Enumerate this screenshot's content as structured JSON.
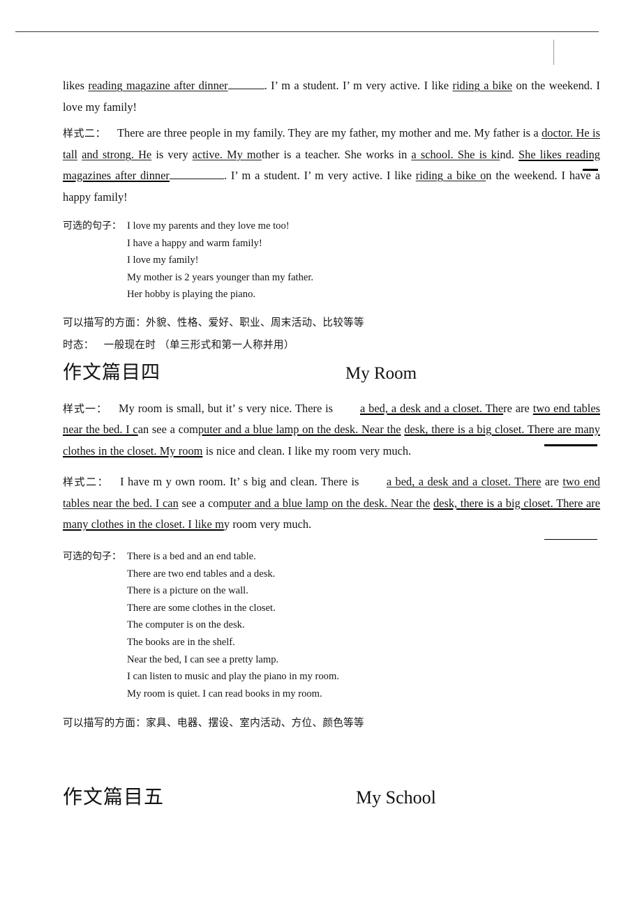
{
  "document": {
    "header_rule": true,
    "margin_mark": "vertical-tick"
  },
  "family_section": {
    "continued_paragraph": {
      "part1": "likes ",
      "underline1": "reading magazine after dinner",
      "part2": ". I’ m a student. I’ m very active. I like ",
      "underline2": "riding a bike",
      "part3": " on the weekend. I love my family!"
    },
    "style_two": {
      "label": "样式二：",
      "t1": "There are three people in my family. They are my father, my mother and me. My father is a ",
      "u1": "doctor. He is tall",
      "t2": " ",
      "u2": "and strong. He",
      "t3": " is very ",
      "u3": "active. My mo",
      "t4": "ther is a teacher. She works in ",
      "u4": "a school. She is ki",
      "t5": "nd. ",
      "u5": "She likes reading magazines after dinner",
      "t6": ". I’ m a student. I’ m very active. I like ",
      "u6": "riding a bike o",
      "t7": "n the weekend. I have a happy family!"
    },
    "optional_label": "可选的句子：",
    "optional_sentences": [
      "I love my parents and they love me too!",
      "I have a happy and warm family!",
      "I love my family!",
      "My mother is 2 years younger than my father.",
      "Her hobby is playing the piano."
    ],
    "aspects_note": "可以描写的方面：外貌、性格、爱好、职业、周末活动、比较等等",
    "tense_label": "时态：",
    "tense_value": "一般现在时 （单三形式和第一人称并用）"
  },
  "room_section": {
    "heading_cn": "作文篇目四",
    "heading_en": "My Room",
    "style_one": {
      "label": "样式一：",
      "t1": "My room is small, but it’ s very nice. There is ",
      "u1": "a bed, a desk and a closet. The",
      "t2": "re are ",
      "u2": "two end tables near the bed. I c",
      "t3": "an see a com",
      "u3": "puter and a blue lamp on the desk. Near the",
      "t4": " ",
      "u4": "desk, there is a big closet. There are many clothes in the closet. My room",
      "t5": " is nice and clean. I like my room very much."
    },
    "style_two": {
      "label": "样式二：",
      "t1": "I have m y own room. It’ s big and clean. There is ",
      "u1": "a bed, a desk and a closet. There",
      "t2": " are ",
      "u2": "two end tables near the bed. I can",
      "t3": " see a com",
      "u3": "puter and a blue lamp on the desk. Near the",
      "t4": " ",
      "u4": "desk, there is a big closet. There are many clothes in the closet. I like m",
      "t5": "y room very much."
    },
    "optional_label": "可选的句子：",
    "optional_sentences": [
      "There is a bed and an end table.",
      "There are two end tables and a desk.",
      "There is a picture on the wall.",
      "There are some clothes in the closet.",
      "The computer is on the desk.",
      "The books are in the shelf.",
      "Near the bed, I can see a pretty lamp.",
      "I can listen to music and play the piano in my room.",
      "My room is quiet. I can read books in my room."
    ],
    "aspects_note": "可以描写的方面：家具、电器、摆设、室内活动、方位、颜色等等"
  },
  "school_section": {
    "heading_cn": "作文篇目五",
    "heading_en": "My School"
  }
}
